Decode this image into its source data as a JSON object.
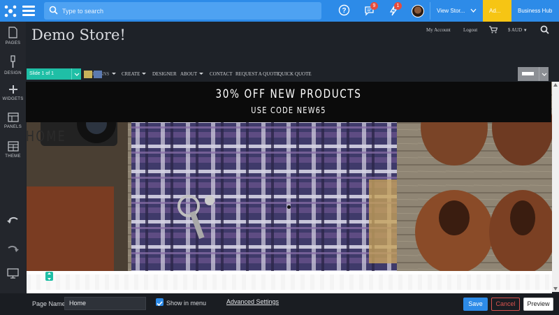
{
  "topbar": {
    "search_placeholder": "Type to search",
    "help_badge": "",
    "messages_badge": "9",
    "notifications_badge": "1",
    "view_store_label": "View Stor...",
    "ad_label": "Ad...",
    "business_hub_label": "Business Hub",
    "brand_color": "#2d8be8",
    "accent_color": "#f6c514"
  },
  "sidebar": {
    "items": [
      {
        "label": "PAGES",
        "icon": "page-icon"
      },
      {
        "label": "DESIGN",
        "icon": "brush-icon"
      },
      {
        "label": "WIDGETS",
        "icon": "plus-icon"
      },
      {
        "label": "PANELS",
        "icon": "panels-icon"
      },
      {
        "label": "THEME",
        "icon": "theme-icon"
      }
    ],
    "undo_icon": "undo-icon",
    "redo_icon": "redo-icon",
    "device_icon": "desktop-icon"
  },
  "store": {
    "title": "Demo Store!",
    "my_account": "My Account",
    "logout": "Logout",
    "currency": "$ AUD",
    "nav": [
      "DESIGNS",
      "CREATE",
      "DESIGNER",
      "ABOUT",
      "CONTACT",
      "REQUEST A QUOTE",
      "QUICK QUOTE"
    ],
    "slide_label": "Slide 1 of 1",
    "promo_line1": "30% OFF NEW PRODUCTS",
    "promo_line2": "USE CODE NEW65",
    "hero_text": "HOME"
  },
  "bottombar": {
    "page_name_label": "Page Name",
    "page_name_value": "Home",
    "show_in_menu_label": "Show in menu",
    "show_in_menu_checked": true,
    "advanced_settings": "Advanced Settings",
    "save": "Save",
    "cancel": "Cancel",
    "preview": "Preview"
  }
}
